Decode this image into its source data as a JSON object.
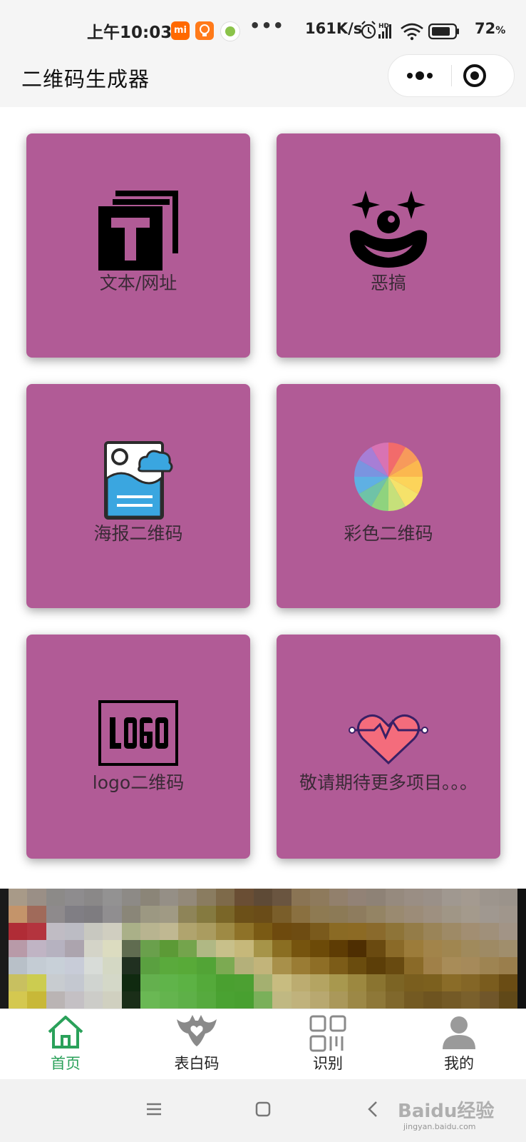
{
  "status_bar": {
    "time": "上午10:03",
    "mi_badge": "mi",
    "more": "•••",
    "net_speed": "161K/s",
    "hd": "HD",
    "battery": "72",
    "battery_unit": "%"
  },
  "header": {
    "title": "二维码生成器"
  },
  "tiles": [
    {
      "label": "文本/网址",
      "icon": "text-t-icon",
      "color": "#b15b96"
    },
    {
      "label": "恶搞",
      "icon": "clown-face-icon",
      "color": "#b15b96"
    },
    {
      "label": "海报二维码",
      "icon": "poster-image-icon",
      "color": "#b15b96"
    },
    {
      "label": "彩色二维码",
      "icon": "color-wheel-icon",
      "color": "#b15b96"
    },
    {
      "label": "logo二维码",
      "icon": "logo-icon",
      "color": "#b15b96"
    },
    {
      "label": "敬请期待更多项目。。。",
      "icon": "heartbeat-icon",
      "color": "#b15b96"
    }
  ],
  "tabbar": {
    "active_color": "#2aa15a",
    "items": [
      {
        "label": "首页",
        "icon": "home-icon"
      },
      {
        "label": "表白码",
        "icon": "bat-heart-icon"
      },
      {
        "label": "识别",
        "icon": "scan-grid-icon"
      },
      {
        "label": "我的",
        "icon": "user-icon"
      }
    ]
  },
  "watermark": {
    "text": "Baidu经验",
    "sub": "jingyan.baidu.com"
  }
}
